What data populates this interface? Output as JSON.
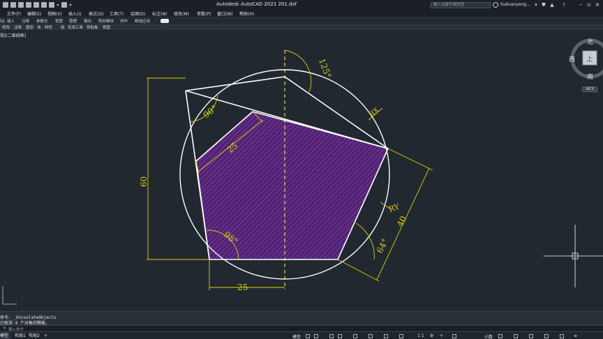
{
  "app": {
    "title": "Autodesk AutoCAD 2021    201.dxf",
    "search_placeholder": "键入关键字或短语",
    "user_name": "liuduanyang...",
    "help_icon": "?"
  },
  "menu": {
    "items": [
      "文件(F)",
      "编辑(E)",
      "视图(V)",
      "插入(I)",
      "格式(O)",
      "工具(T)",
      "绘图(D)",
      "标注(N)",
      "修改(M)",
      "参数(P)",
      "窗口(W)",
      "帮助(H)"
    ]
  },
  "ribbon": {
    "tabs": [
      "默认",
      "插入",
      "注释",
      "参数化",
      "视图",
      "管理",
      "输出",
      "附加模块",
      "协作",
      "精选应用"
    ],
    "active_tab": 0,
    "panels": [
      "修改",
      "注释",
      "图层",
      "块",
      "特性",
      "组",
      "实用工具",
      "剪贴板",
      "视图"
    ]
  },
  "viewport": {
    "label": "视](二维线框]"
  },
  "viewcube": {
    "north": "北",
    "south": "南",
    "west": "西",
    "top": "上",
    "wcs": "WCS"
  },
  "drawing": {
    "dimensions": {
      "angle_top": "125°",
      "angle_left": "90°",
      "angle_bottom_left": "98°",
      "angle_bottom_right": "64°",
      "edge_inner": "25",
      "height": "60",
      "bottom": "25",
      "slant": "40",
      "rx": "RX",
      "ry": "RY"
    },
    "colors": {
      "dimension": "#d6d600",
      "geometry": "#ffffff",
      "hatch_fill": "#4f2470",
      "hatch_line": "#9d3fd0"
    }
  },
  "command": {
    "line1": "命令: _UnisolateObjects",
    "line2": "已取消 4 个对象的隔离。",
    "prompt": "键入命令"
  },
  "status": {
    "layout_tabs": [
      "模型",
      "布局1",
      "布局2"
    ],
    "model_label": "模型",
    "scale": "1:1",
    "units": "小数"
  }
}
